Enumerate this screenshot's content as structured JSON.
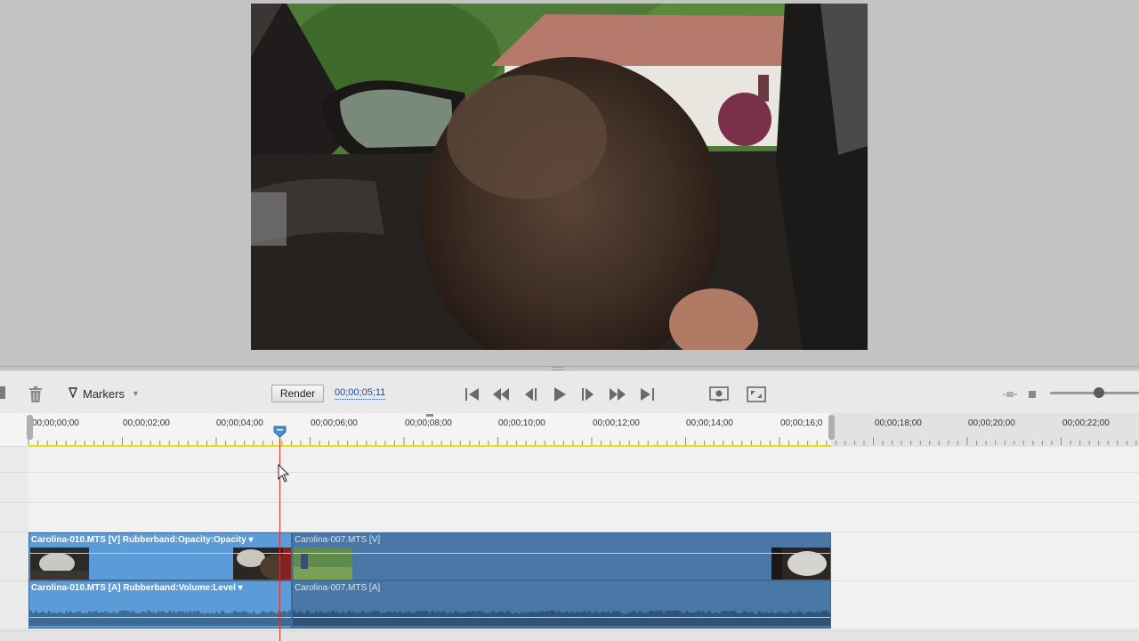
{
  "toolbar": {
    "markers_label": "Markers",
    "render_label": "Render",
    "timecode": "00;00;05;11"
  },
  "ruler": {
    "labels": [
      "00;00;00;00",
      "00;00;02;00",
      "00;00;04;00",
      "00;00;06;00",
      "00;00;08;00",
      "00;00;10;00",
      "00;00;12;00",
      "00;00;14;00",
      "00;00;16;0",
      "00;00;18;00",
      "00;00;20;00",
      "00;00;22;00"
    ]
  },
  "clips": {
    "clip1_video": "Carolina-010.MTS [V]  Rubberband:Opacity:Opacity ▾",
    "clip2_video": "Carolina-007.MTS [V]",
    "clip1_audio": "Carolina-010.MTS [A]  Rubberband:Volume:Level ▾",
    "clip2_audio": "Carolina-007.MTS [A]"
  },
  "colors": {
    "selected_clip": "#5b9bd8",
    "clip": "#4a78a6",
    "playhead": "#e0302c",
    "work_area": "#e8e000"
  }
}
